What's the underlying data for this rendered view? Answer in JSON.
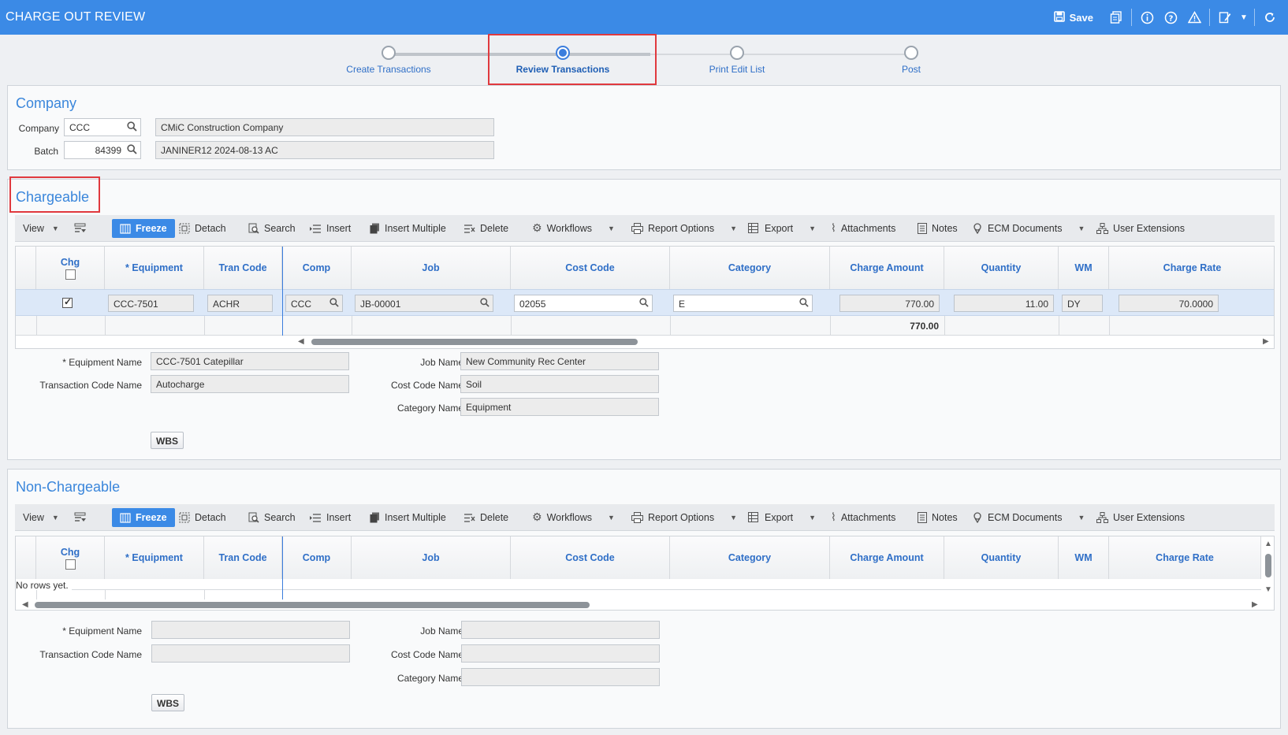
{
  "header": {
    "title": "CHARGE OUT REVIEW",
    "save_label": "Save"
  },
  "wizard": {
    "steps": [
      "Create Transactions",
      "Review Transactions",
      "Print Edit List",
      "Post"
    ],
    "active_index": 1
  },
  "company_section": {
    "title": "Company",
    "company_label": "Company",
    "company_value": "CCC",
    "company_name": "CMiC Construction Company",
    "batch_label": "Batch",
    "batch_value": "84399",
    "batch_desc": "JANINER12 2024-08-13 AC"
  },
  "toolbar": {
    "view": "View",
    "freeze": "Freeze",
    "detach": "Detach",
    "search": "Search",
    "insert": "Insert",
    "insert_multiple": "Insert Multiple",
    "delete": "Delete",
    "workflows": "Workflows",
    "report_options": "Report Options",
    "export": "Export",
    "attachments": "Attachments",
    "notes": "Notes",
    "ecm_documents": "ECM Documents",
    "user_extensions": "User Extensions"
  },
  "columns": [
    "Chg",
    "* Equipment",
    "Tran Code",
    "Comp",
    "Job",
    "Cost Code",
    "Category",
    "Charge Amount",
    "Quantity",
    "WM",
    "Charge Rate"
  ],
  "chargeable": {
    "title": "Chargeable",
    "row": {
      "equipment": "CCC-7501",
      "tran_code": "ACHR",
      "comp": "CCC",
      "job": "JB-00001",
      "cost_code": "02055",
      "category": "E",
      "charge_amount": "770.00",
      "quantity": "11.00",
      "wm": "DY",
      "charge_rate": "70.0000"
    },
    "total_charge_amount": "770.00",
    "detail": {
      "equipment_name_label": "* Equipment Name",
      "equipment_name": "CCC-7501 Catepillar",
      "tran_code_name_label": "Transaction Code Name",
      "tran_code_name": "Autocharge",
      "job_name_label": "Job Name",
      "job_name": "New Community Rec Center",
      "cost_code_name_label": "Cost Code Name",
      "cost_code_name": "Soil",
      "category_name_label": "Category Name",
      "category_name": "Equipment",
      "wbs": "WBS"
    }
  },
  "non_chargeable": {
    "title": "Non-Chargeable",
    "empty_text": "No rows yet.",
    "detail": {
      "equipment_name_label": "* Equipment Name",
      "tran_code_name_label": "Transaction Code Name",
      "job_name_label": "Job Name",
      "cost_code_name_label": "Cost Code Name",
      "category_name_label": "Category Name",
      "wbs": "WBS"
    }
  },
  "colors": {
    "topbar": "#3b8ae6",
    "accent": "#3a86db",
    "highlight": "#e0393e"
  }
}
